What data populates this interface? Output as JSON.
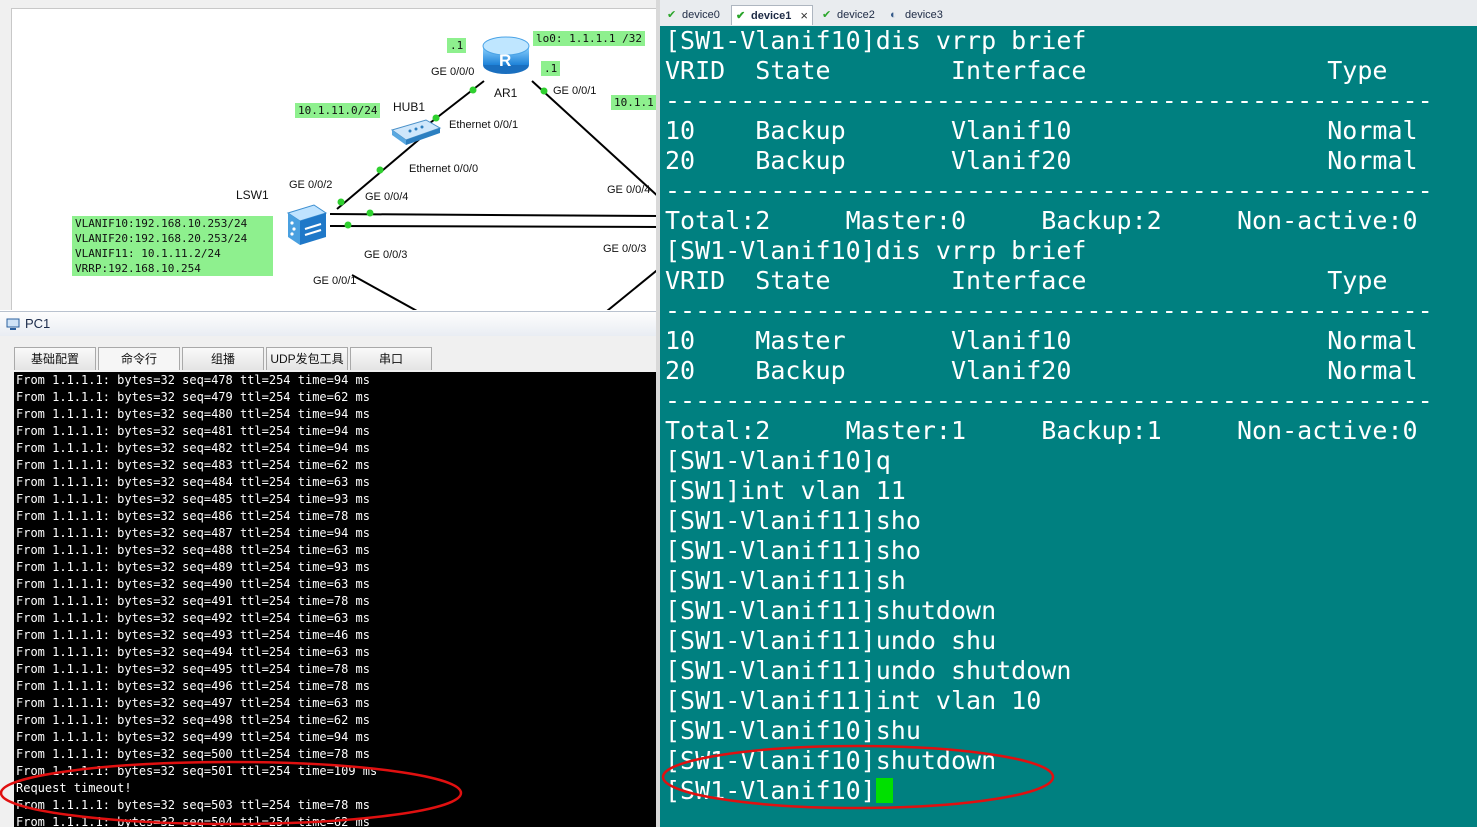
{
  "topology": {
    "devices": {
      "router": "AR1",
      "hub": "HUB1",
      "switch": "LSW1",
      "router_glyph": "R"
    },
    "ports": {
      "ar1_ge000": "GE 0/0/0",
      "ar1_ge001": "GE 0/0/1",
      "hub_eth001": "Ethernet 0/0/1",
      "hub_eth000": "Ethernet 0/0/0",
      "lsw1_ge002": "GE 0/0/2",
      "lsw1_ge004": "GE 0/0/4",
      "lsw1_ge003": "GE 0/0/3",
      "lsw1_ge001": "GE 0/0/1",
      "right_ge004": "GE 0/0/4",
      "right_ge003": "GE 0/0/3"
    },
    "notes": {
      "dot1_left": ".1",
      "dot1_right": ".1",
      "loopback": "lo0: 1.1.1.1 /32",
      "net_10_1_11": "10.1.11.0/24",
      "net_right": "10.1.1",
      "sw_vlanif10": "VLANIF10:192.168.10.253/24",
      "sw_vlanif20": "VLANIF20:192.168.20.253/24",
      "sw_vlanif11": "VLANIF11: 10.1.11.2/24",
      "sw_vrrp": "VRRP:192.168.10.254"
    },
    "note_color": "#8ef08e"
  },
  "pc1": {
    "title": "PC1",
    "tabs": [
      {
        "label": "基础配置"
      },
      {
        "label": "命令行"
      },
      {
        "label": "组播"
      },
      {
        "label": "UDP发包工具"
      },
      {
        "label": "串口"
      }
    ],
    "console_lines": [
      "From 1.1.1.1: bytes=32 seq=478 ttl=254 time=94 ms",
      "From 1.1.1.1: bytes=32 seq=479 ttl=254 time=62 ms",
      "From 1.1.1.1: bytes=32 seq=480 ttl=254 time=94 ms",
      "From 1.1.1.1: bytes=32 seq=481 ttl=254 time=94 ms",
      "From 1.1.1.1: bytes=32 seq=482 ttl=254 time=94 ms",
      "From 1.1.1.1: bytes=32 seq=483 ttl=254 time=62 ms",
      "From 1.1.1.1: bytes=32 seq=484 ttl=254 time=63 ms",
      "From 1.1.1.1: bytes=32 seq=485 ttl=254 time=93 ms",
      "From 1.1.1.1: bytes=32 seq=486 ttl=254 time=78 ms",
      "From 1.1.1.1: bytes=32 seq=487 ttl=254 time=94 ms",
      "From 1.1.1.1: bytes=32 seq=488 ttl=254 time=63 ms",
      "From 1.1.1.1: bytes=32 seq=489 ttl=254 time=93 ms",
      "From 1.1.1.1: bytes=32 seq=490 ttl=254 time=63 ms",
      "From 1.1.1.1: bytes=32 seq=491 ttl=254 time=78 ms",
      "From 1.1.1.1: bytes=32 seq=492 ttl=254 time=63 ms",
      "From 1.1.1.1: bytes=32 seq=493 ttl=254 time=46 ms",
      "From 1.1.1.1: bytes=32 seq=494 ttl=254 time=63 ms",
      "From 1.1.1.1: bytes=32 seq=495 ttl=254 time=78 ms",
      "From 1.1.1.1: bytes=32 seq=496 ttl=254 time=78 ms",
      "From 1.1.1.1: bytes=32 seq=497 ttl=254 time=63 ms",
      "From 1.1.1.1: bytes=32 seq=498 ttl=254 time=62 ms",
      "From 1.1.1.1: bytes=32 seq=499 ttl=254 time=94 ms",
      "From 1.1.1.1: bytes=32 seq=500 ttl=254 time=78 ms",
      "From 1.1.1.1: bytes=32 seq=501 ttl=254 time=109 ms",
      "Request timeout!",
      "From 1.1.1.1: bytes=32 seq=503 ttl=254 time=78 ms",
      "From 1.1.1.1: bytes=32 seq=504 ttl=254 time=62 ms"
    ]
  },
  "terminal": {
    "tabs": [
      {
        "label": "device0",
        "status_icon": "check-icon"
      },
      {
        "label": "device1",
        "status_icon": "check-icon",
        "close": "×"
      },
      {
        "label": "device2",
        "status_icon": "check-icon"
      },
      {
        "label": "device3",
        "status_icon": "power-icon"
      }
    ],
    "background": "#008080",
    "lines": [
      "[SW1-Vlanif10]dis vrrp brief",
      "VRID  State        Interface                Type",
      "---------------------------------------------------",
      "10    Backup       Vlanif10                 Normal",
      "20    Backup       Vlanif20                 Normal",
      "---------------------------------------------------",
      "Total:2     Master:0     Backup:2     Non-active:0",
      "[SW1-Vlanif10]dis vrrp brief",
      "VRID  State        Interface                Type",
      "---------------------------------------------------",
      "10    Master       Vlanif10                 Normal",
      "20    Backup       Vlanif20                 Normal",
      "---------------------------------------------------",
      "Total:2     Master:1     Backup:1     Non-active:0",
      "[SW1-Vlanif10]q",
      "[SW1]int vlan 11",
      "[SW1-Vlanif11]sho",
      "[SW1-Vlanif11]sho",
      "[SW1-Vlanif11]sh",
      "[SW1-Vlanif11]shutdown",
      "[SW1-Vlanif11]undo shu",
      "[SW1-Vlanif11]undo shutdown",
      "[SW1-Vlanif11]int vlan 10",
      "[SW1-Vlanif10]shu",
      "[SW1-Vlanif10]shutdown"
    ],
    "prompt": "[SW1-Vlanif10]"
  },
  "annotation_color": "#e01010"
}
